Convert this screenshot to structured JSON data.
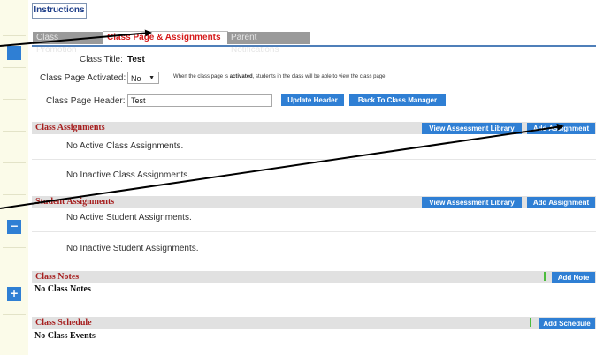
{
  "instructions_label": "Instructions",
  "tabs": [
    {
      "label": "Class Promotion",
      "active": false
    },
    {
      "label": "Class Page & Assignments",
      "active": true
    },
    {
      "label": "Parent Notifications",
      "active": false
    }
  ],
  "form": {
    "class_title_label": "Class Title:",
    "class_title_value": "Test",
    "activated_label": "Class Page Activated:",
    "activated_value": "No",
    "activated_note_pre": "When the class page is ",
    "activated_note_bold": "activated",
    "activated_note_post": ", students in the class will be able to view the class page.",
    "header_label": "Class Page Header:",
    "header_value": "Test",
    "update_header_button": "Update Header",
    "back_button": "Back To Class Manager"
  },
  "class_assignments": {
    "title": "Class Assignments",
    "view_library_button": "View Assessment Library",
    "add_button": "Add Assignment",
    "active_text": "No Active Class Assignments.",
    "inactive_text": "No Inactive Class Assignments."
  },
  "student_assignments": {
    "title": "Student Assignments",
    "view_library_button": "View Assessment Library",
    "add_button": "Add Assignment",
    "active_text": "No Active Student Assignments.",
    "inactive_text": "No Inactive Student Assignments."
  },
  "class_notes": {
    "title": "Class Notes",
    "add_button": "Add Note",
    "empty_text": "No Class Notes"
  },
  "class_schedule": {
    "title": "Class Schedule",
    "add_button": "Add Schedule",
    "empty_text": "No Class Events"
  },
  "left_controls": {
    "minus_symbol": "−",
    "plus_symbol": "+"
  },
  "colors": {
    "button_blue": "#2f7fd4",
    "section_title_red": "#a61e1e",
    "active_tab_red": "#d51b1b",
    "section_bar_gray": "#e1e1e1",
    "left_strip": "#fbfbe9"
  }
}
